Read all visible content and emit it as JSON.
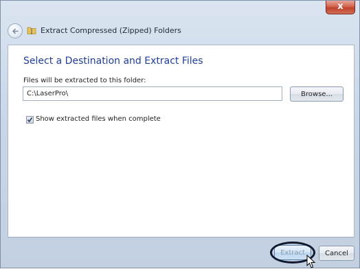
{
  "window": {
    "title": "Extract Compressed (Zipped) Folders",
    "close_glyph": "x"
  },
  "main": {
    "heading": "Select a Destination and Extract Files",
    "field_label": "Files will be extracted to this folder:",
    "path_value": "C:\\LaserPro\\",
    "browse_label": "Browse...",
    "checkbox_label": "Show extracted files when complete",
    "checkbox_checked": true
  },
  "footer": {
    "extract_label": "Extract",
    "cancel_label": "Cancel"
  },
  "icons": {
    "back": "back-arrow-icon",
    "folder": "zip-folder-icon",
    "close": "close-icon",
    "cursor": "mouse-pointer-icon"
  },
  "colors": {
    "heading": "#1f3d99",
    "close_button": "#c0422b",
    "highlight_ring": "#10182e"
  }
}
